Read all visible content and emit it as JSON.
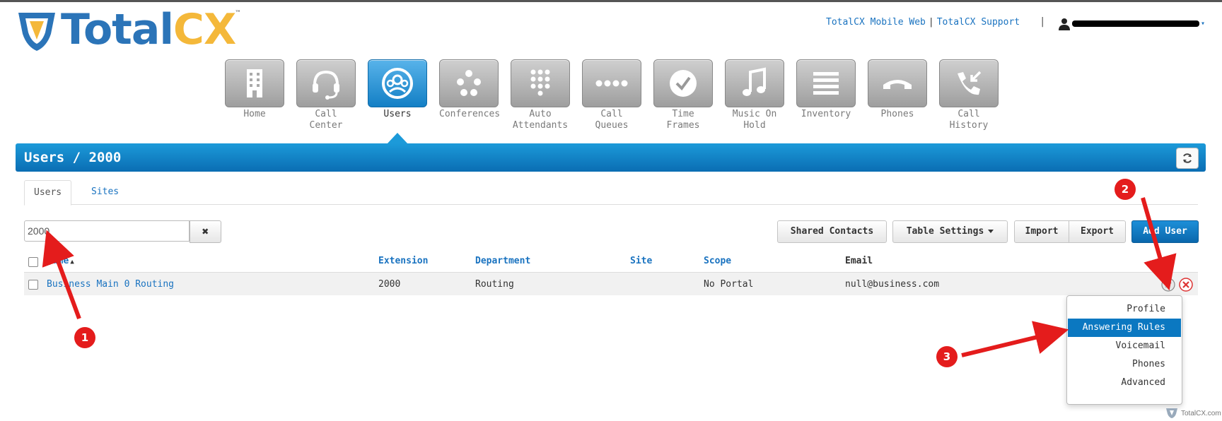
{
  "brand": {
    "name_part1": "Total",
    "name_part2": "CX",
    "trademark": "™",
    "footer_text": "TotalCX.com"
  },
  "header": {
    "link_mobile": "TotalCX Mobile Web",
    "separator": "|",
    "link_support": "TotalCX Support",
    "user_menu_separator": "|"
  },
  "nav": {
    "items": [
      {
        "label": "Home",
        "icon": "building-icon"
      },
      {
        "label": "Call\nCenter",
        "icon": "headset-icon"
      },
      {
        "label": "Users",
        "icon": "users-icon",
        "active": true
      },
      {
        "label": "Conferences",
        "icon": "conference-icon"
      },
      {
        "label": "Auto\nAttendants",
        "icon": "keypad-icon"
      },
      {
        "label": "Call\nQueues",
        "icon": "queue-icon"
      },
      {
        "label": "Time\nFrames",
        "icon": "clock-icon"
      },
      {
        "label": "Music On\nHold",
        "icon": "music-icon"
      },
      {
        "label": "Inventory",
        "icon": "list-icon"
      },
      {
        "label": "Phones",
        "icon": "phone-icon"
      },
      {
        "label": "Call\nHistory",
        "icon": "call-history-icon"
      }
    ]
  },
  "page": {
    "title": "Users / 2000"
  },
  "tabs": {
    "users": "Users",
    "sites": "Sites"
  },
  "search": {
    "value": "2000"
  },
  "toolbar": {
    "shared_contacts": "Shared Contacts",
    "table_settings": "Table Settings",
    "import": "Import",
    "export": "Export",
    "add_user": "Add User"
  },
  "table": {
    "columns": {
      "name": "Name",
      "extension": "Extension",
      "department": "Department",
      "site": "Site",
      "scope": "Scope",
      "email": "Email"
    },
    "rows": [
      {
        "name": "Business Main 0 Routing",
        "extension": "2000",
        "department": "Routing",
        "site": "",
        "scope": "No Portal",
        "email": "null@business.com"
      }
    ]
  },
  "dropdown": {
    "items": [
      "Profile",
      "Answering Rules",
      "Voicemail",
      "Phones",
      "Advanced"
    ],
    "selected": "Answering Rules"
  },
  "annotations": {
    "markers": [
      "1",
      "2",
      "3"
    ]
  },
  "colors": {
    "accent": "#0b78c1",
    "link": "#1a73c0",
    "marker": "#e41c1c",
    "logo_blue": "#2b74b8",
    "logo_yellow": "#f4b83a"
  }
}
